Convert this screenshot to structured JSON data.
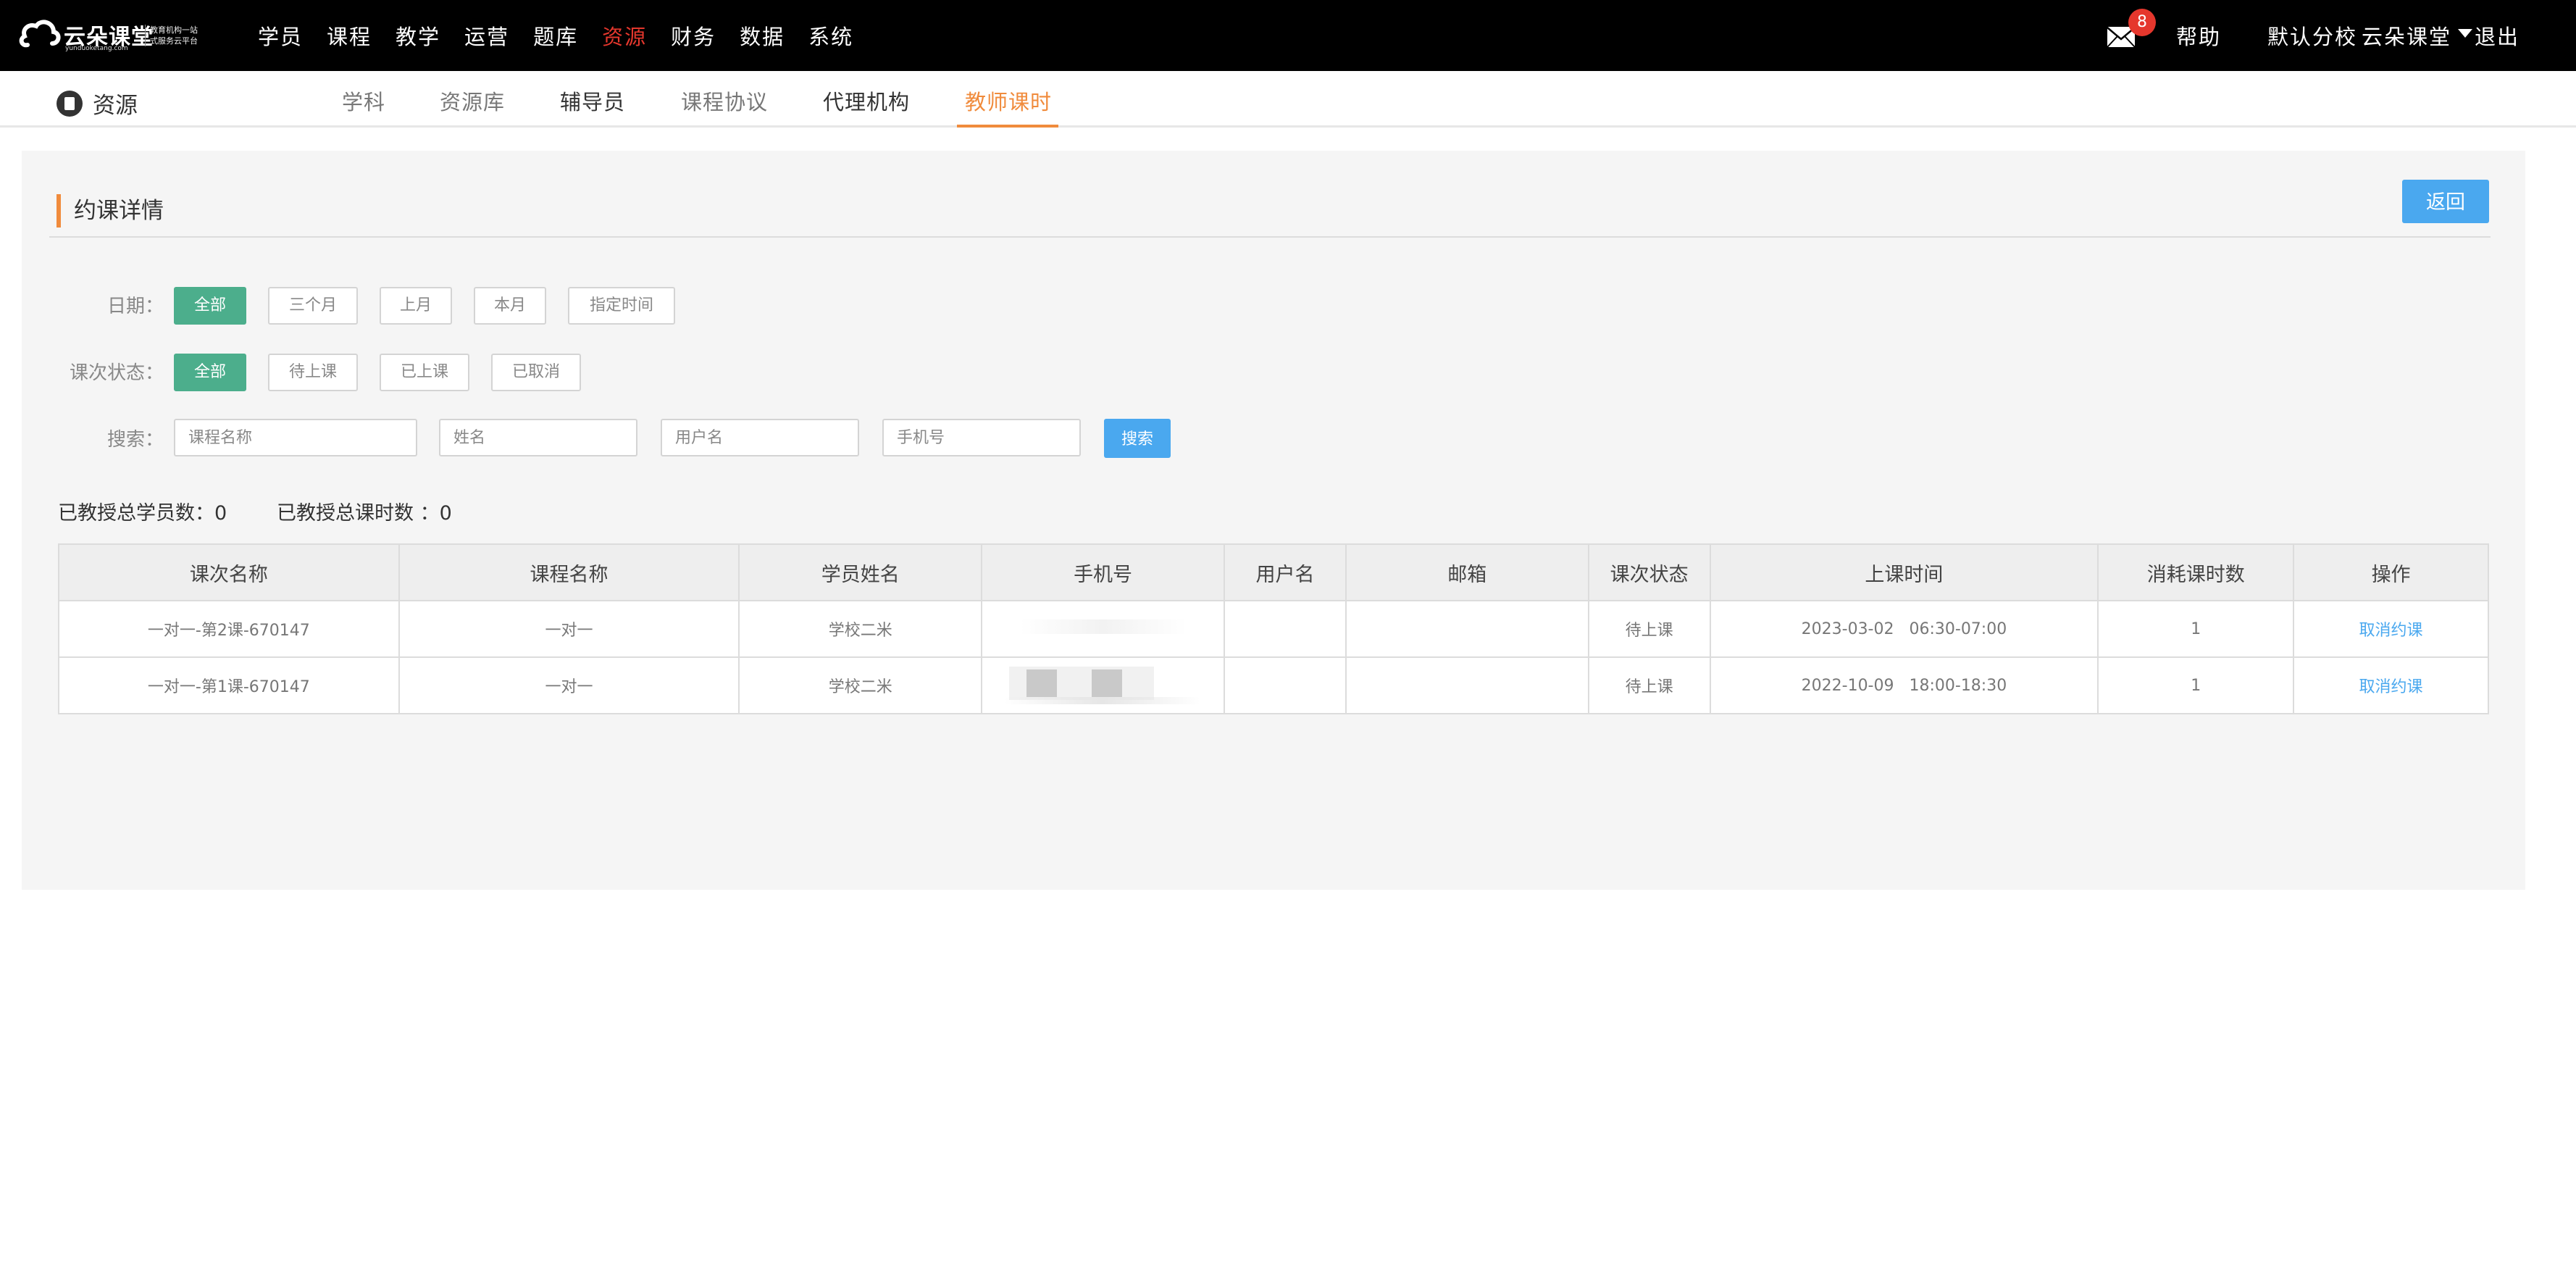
{
  "logo": {
    "name": "云朵课堂",
    "domain": "yunduoketang.com",
    "slogan_1": "教育机构一站",
    "slogan_2": "式服务云平台"
  },
  "nav": {
    "items": [
      "学员",
      "课程",
      "教学",
      "运营",
      "题库",
      "资源",
      "财务",
      "数据",
      "系统"
    ],
    "active": "资源"
  },
  "topright": {
    "mail_count": "8",
    "help": "帮助",
    "branch": "默认分校",
    "user": "云朵课堂",
    "logout": "退出"
  },
  "section": {
    "title": "资源"
  },
  "subtabs": {
    "items": [
      "学科",
      "资源库",
      "辅导员",
      "课程协议",
      "代理机构",
      "教师课时"
    ],
    "active": "教师课时"
  },
  "panel": {
    "title": "约课详情",
    "back": "返回"
  },
  "filters": {
    "date_label": "日期：",
    "date_options": [
      "全部",
      "三个月",
      "上月",
      "本月",
      "指定时间"
    ],
    "status_label": "课次状态：",
    "status_options": [
      "全部",
      "待上课",
      "已上课",
      "已取消"
    ],
    "search_label": "搜索：",
    "search_placeholders": [
      "课程名称",
      "姓名",
      "用户名",
      "手机号"
    ],
    "search_button": "搜索"
  },
  "stats": {
    "students": "已教授总学员数：0",
    "hours": "已教授总课时数 ：0"
  },
  "table": {
    "headers": [
      "课次名称",
      "课程名称",
      "学员姓名",
      "手机号",
      "用户名",
      "邮箱",
      "课次状态",
      "上课时间",
      "消耗课时数",
      "操作"
    ],
    "rows": [
      {
        "lesson": "一对一-第2课-670147",
        "course": "一对一",
        "student": "学校二米",
        "phone": "",
        "username": "",
        "email": "",
        "status": "待上课",
        "time": "2023-03-02   06:30-07:00",
        "hours": "1",
        "action": "取消约课"
      },
      {
        "lesson": "一对一-第1课-670147",
        "course": "一对一",
        "student": "学校二米",
        "phone": "",
        "username": "",
        "email": "",
        "status": "待上课",
        "time": "2022-10-09   18:00-18:30",
        "hours": "1",
        "action": "取消约课"
      }
    ]
  }
}
